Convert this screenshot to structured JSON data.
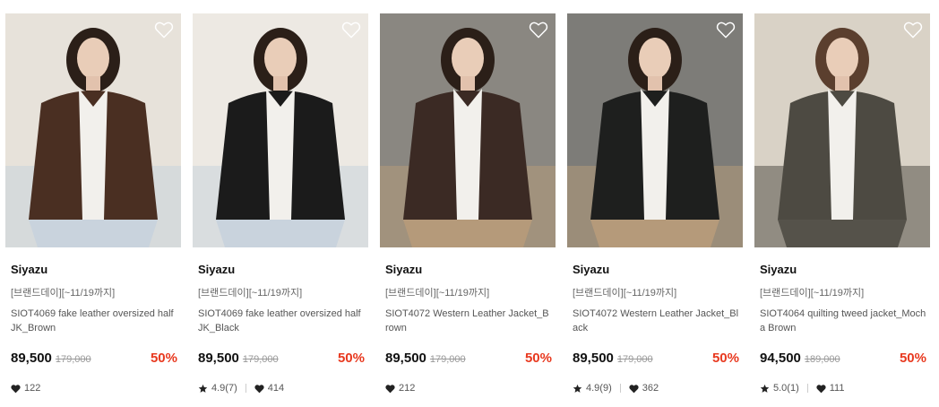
{
  "products": [
    {
      "brand": "Siyazu",
      "tag": "[브랜드데이][~11/19까지]",
      "name": "SIOT4069 fake leather oversized half JK_Brown",
      "price": "89,500",
      "original_price": "179,000",
      "discount": "50%",
      "rating": "",
      "likes": "122",
      "bg": "#e7e2da",
      "jacket": "#4a2f22"
    },
    {
      "brand": "Siyazu",
      "tag": "[브랜드데이][~11/19까지]",
      "name": "SIOT4069 fake leather oversized half JK_Black",
      "price": "89,500",
      "original_price": "179,000",
      "discount": "50%",
      "rating": "4.9(7)",
      "likes": "414",
      "bg": "#ede9e3",
      "jacket": "#1b1b1b"
    },
    {
      "brand": "Siyazu",
      "tag": "[브랜드데이][~11/19까지]",
      "name": "SIOT4072 Western Leather Jacket_Brown",
      "price": "89,500",
      "original_price": "179,000",
      "discount": "50%",
      "rating": "",
      "likes": "212",
      "bg": "#8a8781",
      "jacket": "#3b2a24"
    },
    {
      "brand": "Siyazu",
      "tag": "[브랜드데이][~11/19까지]",
      "name": "SIOT4072 Western Leather Jacket_Black",
      "price": "89,500",
      "original_price": "179,000",
      "discount": "50%",
      "rating": "4.9(9)",
      "likes": "362",
      "bg": "#7d7c78",
      "jacket": "#1e1f1e"
    },
    {
      "brand": "Siyazu",
      "tag": "[브랜드데이][~11/19까지]",
      "name": "SIOT4064 quilting tweed jacket_Mocha Brown",
      "price": "94,500",
      "original_price": "189,000",
      "discount": "50%",
      "rating": "5.0(1)",
      "likes": "111",
      "bg": "#d9d2c6",
      "jacket": "#4d4a42"
    }
  ]
}
